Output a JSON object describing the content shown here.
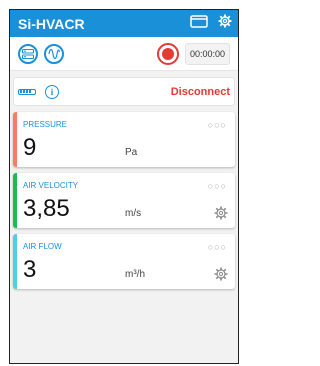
{
  "app": {
    "title": "Si-HVACR"
  },
  "toolbar": {
    "timer": "00:00:00"
  },
  "device": {
    "disconnect_label": "Disconnect"
  },
  "cards": [
    {
      "label": "PRESSURE",
      "value": "9",
      "unit": "Pa",
      "color": "#ff7a66"
    },
    {
      "label": "AIR VELOCITY",
      "value": "3,85",
      "unit": "m/s",
      "color": "#1db954"
    },
    {
      "label": "AIR FLOW",
      "value": "3",
      "unit": "m³/h",
      "color": "#4dd0e1"
    }
  ],
  "colors": {
    "accent": "#1a90d8",
    "record": "#e53935"
  },
  "icons": [
    "window-icon",
    "settings-icon",
    "list-icon",
    "waveform-icon",
    "record-icon",
    "battery-icon",
    "info-icon",
    "more-icon",
    "gear-icon"
  ]
}
